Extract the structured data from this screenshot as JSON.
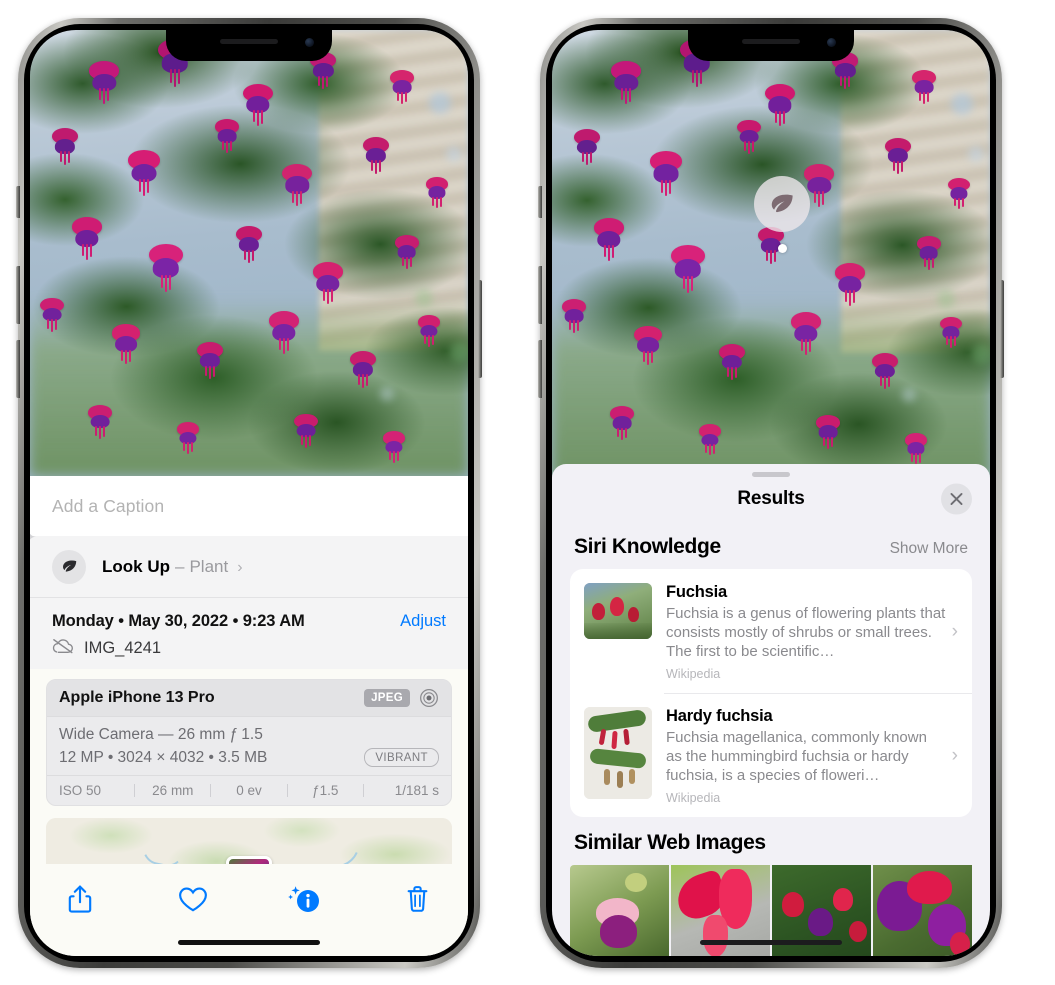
{
  "left_phone": {
    "name": "iphone-photos-info",
    "photo": {
      "alt": "fuchsia-flowers-hanging-basket"
    },
    "caption_input": {
      "placeholder": "Add a Caption",
      "value": ""
    },
    "look_up": {
      "icon": "leaf-icon",
      "sparkle_icon": "sparkles-icon",
      "label": "Look Up",
      "dash": "–",
      "subject": "Plant",
      "chevron": "›"
    },
    "date": "Monday • May 30, 2022 • 9:23 AM",
    "adjust_label": "Adjust",
    "cloud_icon": "icloud-slash-icon",
    "filename": "IMG_4241",
    "exif": {
      "model": "Apple iPhone 13 Pro",
      "format_badge": "JPEG",
      "aperture_icon": "aperture-icon",
      "lens_line": "Wide Camera — 26 mm ƒ 1.5",
      "size_line": "12 MP • 3024 × 4032 • 3.5 MB",
      "style_badge": "VIBRANT",
      "stats": [
        "ISO 50",
        "26 mm",
        "0 ev",
        "ƒ1.5",
        "1/181 s"
      ]
    },
    "map": {
      "name": "location-map-thumbnail",
      "pin": "photo-pin"
    },
    "toolbar": [
      {
        "name": "share-button",
        "icon": "share-icon"
      },
      {
        "name": "favorite-button",
        "icon": "heart-icon"
      },
      {
        "name": "info-button",
        "icon": "info-sparkle-icon"
      },
      {
        "name": "delete-button",
        "icon": "trash-icon"
      }
    ]
  },
  "right_phone": {
    "name": "iphone-visual-look-up-results",
    "vlu_badge": {
      "icon": "leaf-icon",
      "name": "visual-look-up-badge"
    },
    "sheet": {
      "grabber": "sheet-grabber",
      "title": "Results",
      "close_icon": "close-icon",
      "sections": [
        {
          "name": "siri-knowledge",
          "title": "Siri Knowledge",
          "action": "Show More",
          "cards": [
            {
              "title": "Fuchsia",
              "description": "Fuchsia is a genus of flowering plants that consists mostly of shrubs or small trees. The first to be scientific…",
              "source": "Wikipedia",
              "thumb": "fuchsia-flower-thumbnail",
              "chevron": "›"
            },
            {
              "title": "Hardy fuchsia",
              "description": "Fuchsia magellanica, commonly known as the hummingbird fuchsia or hardy fuchsia, is a species of floweri…",
              "source": "Wikipedia",
              "thumb": "hardy-fuchsia-specimen-thumbnail",
              "chevron": "›"
            }
          ]
        },
        {
          "name": "similar-web-images",
          "title": "Similar Web Images",
          "images": [
            {
              "name": "web-image-1",
              "alt": "pink-purple-fuchsia-bloom"
            },
            {
              "name": "web-image-2",
              "alt": "red-fuchsia-closeup"
            },
            {
              "name": "web-image-3",
              "alt": "fuchsia-shrub-buds"
            },
            {
              "name": "web-image-4",
              "alt": "purple-fuchsia-cluster"
            }
          ]
        }
      ]
    }
  },
  "colors": {
    "accent_blue": "#007aff",
    "sheet_bg": "#f2f1f6",
    "card_bg": "#ffffff",
    "secondary_text": "#8a8a8e",
    "pane_bg": "#f4f4f5"
  }
}
